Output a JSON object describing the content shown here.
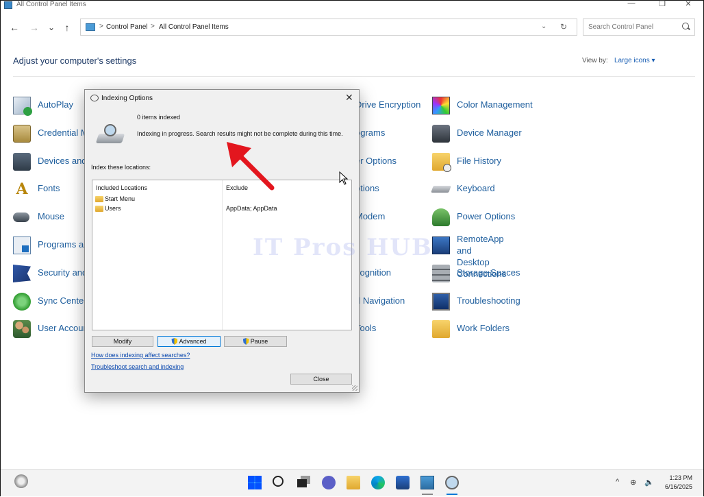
{
  "window": {
    "title": "All Control Panel Items",
    "controls": {
      "minimize": "—",
      "maximize": "❐",
      "close": "✕"
    }
  },
  "nav": {
    "back": "←",
    "forward": "→",
    "recent": "⌄",
    "up": "↑"
  },
  "address": {
    "crumbs": [
      "Control Panel",
      "All Control Panel Items"
    ],
    "separator": ">",
    "dropdown": "⌄",
    "refresh": "↻"
  },
  "search": {
    "placeholder": "Search Control Panel"
  },
  "header": {
    "title": "Adjust your computer's settings",
    "view_by_label": "View by:",
    "view_by_value": "Large icons ▾"
  },
  "items": {
    "col1": [
      "AutoPlay",
      "Credential M",
      "Devices and",
      "Fonts",
      "Mouse",
      "Programs ar",
      "Security and",
      "Sync Center",
      "User Accour"
    ],
    "col2": [
      "Drive Encryption",
      "ograms",
      "er Options",
      "ptions",
      "Modem",
      "",
      "cognition",
      "d Navigation",
      "Tools"
    ],
    "col3": [
      "Color Management",
      "Device Manager",
      "File History",
      "Keyboard",
      "Power Options",
      "RemoteApp and Desktop\nConnections",
      "Storage Spaces",
      "Troubleshooting",
      "Work Folders"
    ]
  },
  "dialog": {
    "title": "Indexing Options",
    "close": "✕",
    "items_indexed": "0 items indexed",
    "status": "Indexing in progress. Search results might not be complete during this time.",
    "index_label": "Index these locations:",
    "columns": {
      "included": "Included Locations",
      "exclude": "Exclude"
    },
    "locations": [
      {
        "name": "Start Menu",
        "exclude": ""
      },
      {
        "name": "Users",
        "exclude": "AppData; AppData"
      }
    ],
    "buttons": {
      "modify": "Modify",
      "advanced": "Advanced",
      "pause": "Pause",
      "close": "Close"
    },
    "links": {
      "how": "How does indexing affect searches?",
      "troubleshoot": "Troubleshoot search and indexing"
    }
  },
  "watermark": "IT Pros HUB",
  "taskbar": {
    "time": "1:23 PM",
    "date": "6/16/2025",
    "chevron": "^",
    "globe": "⊕",
    "speaker": "🔈"
  },
  "colors": {
    "accent": "#0078d7",
    "link": "#1f5f9e",
    "arrow": "#e3161e"
  }
}
